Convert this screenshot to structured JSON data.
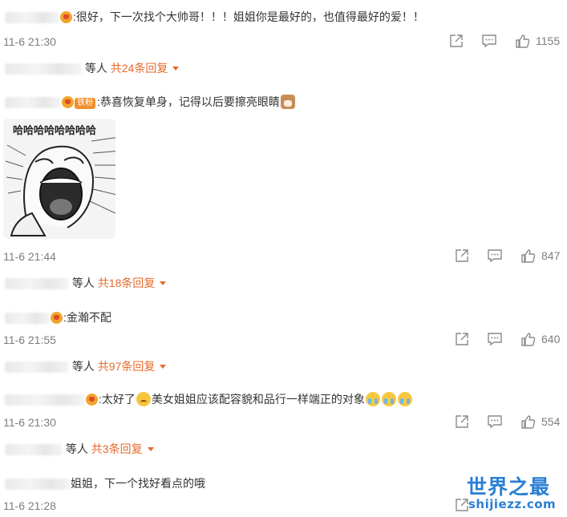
{
  "comments": [
    {
      "text": ":很好，下一次找个大帅哥！！！姐姐你是最好的，也值得最好的爱！！",
      "time": "11-6 21:30",
      "likes": "1155",
      "replies": {
        "etc": "等人",
        "count": "共24条回复"
      }
    },
    {
      "fan_badge": "铁粉",
      "text": ":恭喜恢复单身，记得以后要擦亮眼睛",
      "emoji": "cat-face-emoji",
      "image_caption": "哈哈哈哈哈哈哈哈",
      "time": "11-6 21:44",
      "likes": "847",
      "replies": {
        "etc": "等人",
        "count": "共18条回复"
      }
    },
    {
      "text": ":金瀚不配",
      "time": "11-6 21:55",
      "likes": "640",
      "replies": {
        "etc": "等人",
        "count": "共97条回复"
      }
    },
    {
      "text_a": ":太好了",
      "text_b": "美女姐姐应该配容貌和品行一样端正的对象",
      "emoji_a": "sad-face-emoji",
      "emoji_b": "crying-face-emoji",
      "time": "11-6 21:30",
      "likes": "554",
      "replies": {
        "etc": "等人",
        "count": "共3条回复"
      }
    },
    {
      "text": "姐姐，下一个找好看点的哦",
      "time": "11-6 21:28"
    }
  ],
  "icons": {
    "share": "share-icon",
    "comment": "comment-icon",
    "like": "thumbs-up-icon",
    "expand": "caret-down-icon"
  },
  "colors": {
    "accent": "#e66a2b",
    "watermark": "#2a7fd4",
    "muted": "#7d7d7d"
  },
  "watermark": {
    "title": "世界之最",
    "domain": "shijiezz.com"
  }
}
